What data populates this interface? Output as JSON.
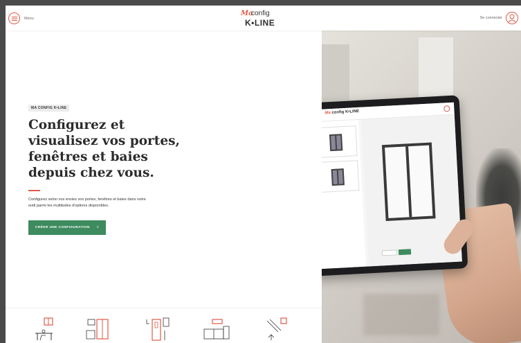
{
  "header": {
    "menu_label": "Menu",
    "logo_ma": "Ma",
    "logo_config": "config",
    "logo_kline": "K•LINE",
    "login_label": "Se connecter"
  },
  "hero": {
    "eyebrow": "MA CONFIG K•LINE",
    "title": "Configurez et\nvisualisez vos portes,\nfenêtres et baies\ndepuis chez vous.",
    "description": "Configurez selon vos envies vos portes, fenêtres et baies dans notre\noutil parmi les multitudes d'options disponibles.",
    "cta_label": "CRÉER UNE CONFIGURATION",
    "cta_arrow": ">"
  },
  "colors": {
    "accent": "#e05a47",
    "cta": "#3d8b5e",
    "text": "#2b2b2b"
  },
  "categories": [
    {
      "icon": "office-window-icon"
    },
    {
      "icon": "living-room-window-icon"
    },
    {
      "icon": "door-icon"
    },
    {
      "icon": "kitchen-window-icon"
    },
    {
      "icon": "staircase-window-icon"
    }
  ],
  "tablet": {
    "logo_ma": "Ma",
    "logo_text": "config K•LINE"
  }
}
